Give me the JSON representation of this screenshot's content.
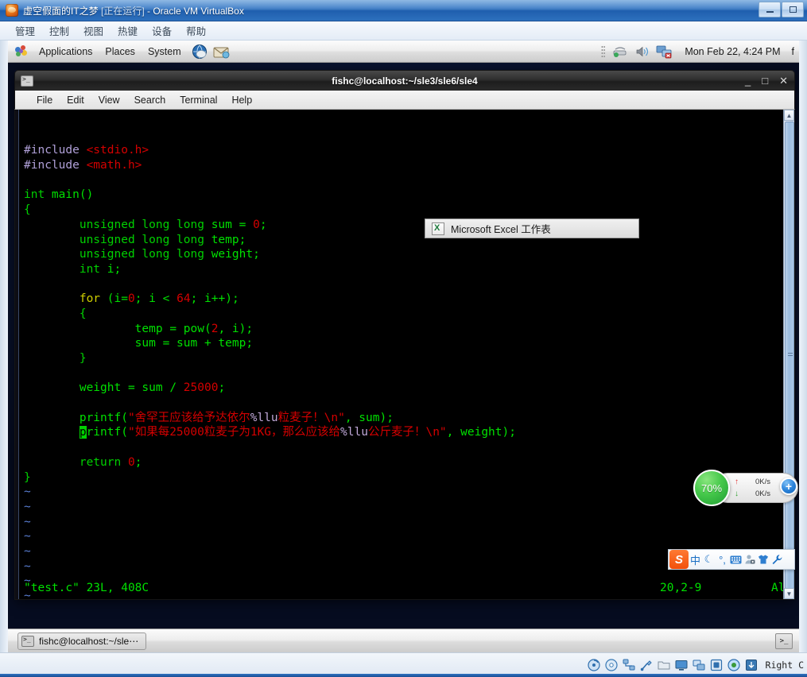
{
  "vbox": {
    "title_main": "虚空假面的IT之梦",
    "title_state": "[正在运行]",
    "title_suffix": " - Oracle VM VirtualBox",
    "window_buttons": {
      "minimize": "minimize-icon",
      "maximize": "maximize-icon"
    },
    "menu": [
      "管理",
      "控制",
      "视图",
      "热键",
      "设备",
      "帮助"
    ],
    "statusbar": {
      "icons": [
        "hard-disk-icon",
        "cd-dvd-icon",
        "network-icon",
        "usb-icon",
        "shared-folder-icon",
        "display-icon",
        "remote-desktop-icon",
        "video-capture-icon",
        "vm-icon",
        "mouse-integration-icon",
        "host-key-icon"
      ],
      "host_key": "Right C"
    }
  },
  "gnome_panel": {
    "foot_icon": "gnome-foot-icon",
    "menus": [
      "Applications",
      "Places",
      "System"
    ],
    "launchers": [
      "web-browser-icon",
      "email-client-icon"
    ],
    "tray": [
      "network-manager-icon",
      "volume-icon",
      "display-disconnected-icon"
    ],
    "clock": "Mon Feb 22,  4:24 PM",
    "user": "f"
  },
  "terminal": {
    "title": "fishc@localhost:~/sle3/sle6/sle4",
    "icon": "terminal-icon",
    "window_buttons": {
      "minimize": "_",
      "maximize": "□",
      "close": "✕"
    },
    "menu": [
      "File",
      "Edit",
      "View",
      "Search",
      "Terminal",
      "Help"
    ],
    "scrollbar": {
      "up": "▲",
      "down": "▼"
    }
  },
  "editor": {
    "lines": [
      {
        "id": 1,
        "tokens": [
          {
            "t": "#include ",
            "c": "preproc"
          },
          {
            "t": "<stdio.h>",
            "c": "string"
          }
        ]
      },
      {
        "id": 2,
        "tokens": [
          {
            "t": "#include ",
            "c": "preproc"
          },
          {
            "t": "<math.h>",
            "c": "string"
          }
        ]
      },
      {
        "id": 3,
        "tokens": []
      },
      {
        "id": 4,
        "tokens": [
          {
            "t": "int ",
            "c": "type"
          },
          {
            "t": "main()",
            "c": "ident"
          }
        ]
      },
      {
        "id": 5,
        "tokens": [
          {
            "t": "{",
            "c": "plain"
          }
        ]
      },
      {
        "id": 6,
        "tokens": [
          {
            "t": "        unsigned long long ",
            "c": "type"
          },
          {
            "t": "sum = ",
            "c": "ident"
          },
          {
            "t": "0",
            "c": "num"
          },
          {
            "t": ";",
            "c": "ident"
          }
        ]
      },
      {
        "id": 7,
        "tokens": [
          {
            "t": "        unsigned long long ",
            "c": "type"
          },
          {
            "t": "temp;",
            "c": "ident"
          }
        ]
      },
      {
        "id": 8,
        "tokens": [
          {
            "t": "        unsigned long long ",
            "c": "type"
          },
          {
            "t": "weight;",
            "c": "ident"
          }
        ]
      },
      {
        "id": 9,
        "tokens": [
          {
            "t": "        int ",
            "c": "type"
          },
          {
            "t": "i;",
            "c": "ident"
          }
        ]
      },
      {
        "id": 10,
        "tokens": []
      },
      {
        "id": 11,
        "tokens": [
          {
            "t": "        ",
            "c": "plain"
          },
          {
            "t": "for ",
            "c": "kw"
          },
          {
            "t": "(i=",
            "c": "ident"
          },
          {
            "t": "0",
            "c": "num"
          },
          {
            "t": "; i < ",
            "c": "ident"
          },
          {
            "t": "64",
            "c": "num"
          },
          {
            "t": "; i++);",
            "c": "ident"
          }
        ]
      },
      {
        "id": 12,
        "tokens": [
          {
            "t": "        {",
            "c": "plain"
          }
        ]
      },
      {
        "id": 13,
        "tokens": [
          {
            "t": "                temp = pow(",
            "c": "ident"
          },
          {
            "t": "2",
            "c": "num"
          },
          {
            "t": ", i);",
            "c": "ident"
          }
        ]
      },
      {
        "id": 14,
        "tokens": [
          {
            "t": "                sum = sum + temp;",
            "c": "ident"
          }
        ]
      },
      {
        "id": 15,
        "tokens": [
          {
            "t": "        }",
            "c": "plain"
          }
        ]
      },
      {
        "id": 16,
        "tokens": []
      },
      {
        "id": 17,
        "tokens": [
          {
            "t": "        weight = sum / ",
            "c": "ident"
          },
          {
            "t": "25000",
            "c": "num"
          },
          {
            "t": ";",
            "c": "ident"
          }
        ]
      },
      {
        "id": 18,
        "tokens": []
      },
      {
        "id": 19,
        "tokens": [
          {
            "t": "        printf(",
            "c": "ident"
          },
          {
            "t": "\"舍罕王应该给予达依尔",
            "c": "string"
          },
          {
            "t": "%llu",
            "c": "fmt"
          },
          {
            "t": "粒麦子！\\n\"",
            "c": "string"
          },
          {
            "t": ", sum);",
            "c": "ident"
          }
        ]
      },
      {
        "id": 20,
        "tokens": [
          {
            "t": "        ",
            "c": "plain"
          },
          {
            "t": "p",
            "c": "cursor"
          },
          {
            "t": "rintf(",
            "c": "ident"
          },
          {
            "t": "\"如果每25000粒麦子为1KG，那么应该给",
            "c": "string"
          },
          {
            "t": "%llu",
            "c": "fmt"
          },
          {
            "t": "公斤麦子！\\n\"",
            "c": "string"
          },
          {
            "t": ", weight);",
            "c": "ident"
          }
        ]
      },
      {
        "id": 21,
        "tokens": []
      },
      {
        "id": 22,
        "tokens": [
          {
            "t": "        return ",
            "c": "type"
          },
          {
            "t": "0",
            "c": "num"
          },
          {
            "t": ";",
            "c": "ident"
          }
        ]
      },
      {
        "id": 23,
        "tokens": [
          {
            "t": "}",
            "c": "plain"
          }
        ]
      },
      {
        "id": 24,
        "tokens": [
          {
            "t": "~",
            "c": "tilde"
          }
        ]
      },
      {
        "id": 25,
        "tokens": [
          {
            "t": "~",
            "c": "tilde"
          }
        ]
      },
      {
        "id": 26,
        "tokens": [
          {
            "t": "~",
            "c": "tilde"
          }
        ]
      },
      {
        "id": 27,
        "tokens": [
          {
            "t": "~",
            "c": "tilde"
          }
        ]
      },
      {
        "id": 28,
        "tokens": [
          {
            "t": "~",
            "c": "tilde"
          }
        ]
      },
      {
        "id": 29,
        "tokens": [
          {
            "t": "~",
            "c": "tilde"
          }
        ]
      },
      {
        "id": 30,
        "tokens": [
          {
            "t": "~",
            "c": "tilde"
          }
        ]
      },
      {
        "id": 31,
        "tokens": [
          {
            "t": "~",
            "c": "tilde"
          }
        ]
      },
      {
        "id": 32,
        "tokens": [
          {
            "t": "~",
            "c": "tilde"
          }
        ]
      },
      {
        "id": 33,
        "tokens": [
          {
            "t": "~",
            "c": "tilde"
          }
        ]
      }
    ],
    "status": {
      "file": "\"test.c\" 23L, 408C",
      "position": "20,2-9",
      "view": "All"
    }
  },
  "excel_popup": {
    "icon": "excel-file-icon",
    "label": "Microsoft Excel 工作表"
  },
  "netspeed": {
    "percent": "70%",
    "upload_arrow": "↑",
    "upload": "0K/s",
    "download_arrow": "↓",
    "download": "0K/s",
    "add_button": "+",
    "color": "#2ca33c"
  },
  "ime": {
    "logo": "S",
    "items": [
      {
        "name": "language-mode-icon",
        "glyph": "中"
      },
      {
        "name": "moon-mode-icon",
        "glyph": "☾"
      },
      {
        "name": "punctuation-mode-icon",
        "glyph": "°,"
      },
      {
        "name": "soft-keyboard-icon",
        "glyph": "⌨"
      },
      {
        "name": "user-account-icon",
        "glyph": "👤"
      },
      {
        "name": "skin-icon",
        "glyph": "👕"
      },
      {
        "name": "settings-wrench-icon",
        "glyph": "🔧"
      }
    ]
  },
  "taskbar": {
    "item_label": "fishc@localhost:~/sle⋯",
    "item_icon": "terminal-icon",
    "tray_icon": "terminal-tray-icon"
  }
}
